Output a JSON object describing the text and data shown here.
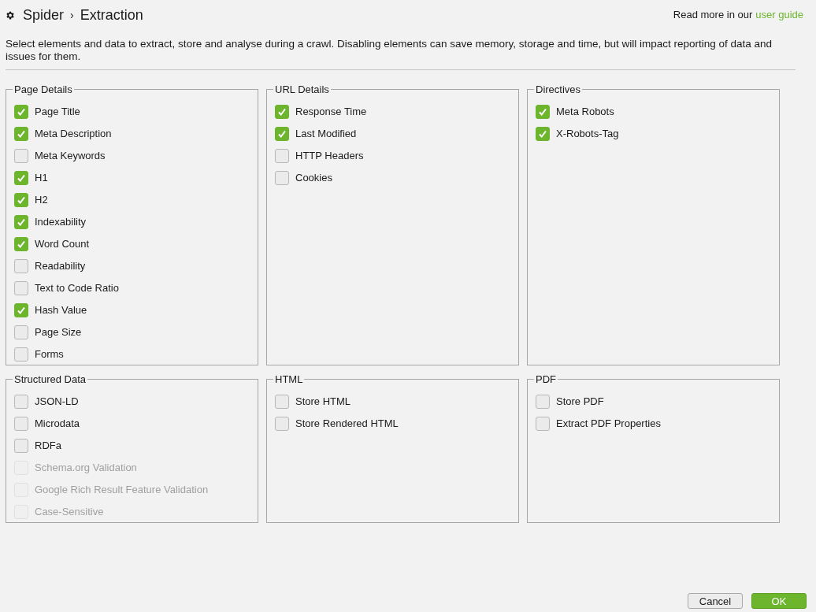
{
  "header": {
    "breadcrumb": [
      "Spider",
      "Extraction"
    ],
    "separator": "›",
    "help_text": "Read more in our",
    "help_link": "user guide"
  },
  "description": "Select elements and data to extract, store and analyse during a crawl. Disabling elements can save memory, storage and time, but will impact reporting of data and issues for them.",
  "groups": [
    {
      "title": "Page Details",
      "items": [
        {
          "label": "Page Title",
          "checked": true,
          "disabled": false
        },
        {
          "label": "Meta Description",
          "checked": true,
          "disabled": false
        },
        {
          "label": "Meta Keywords",
          "checked": false,
          "disabled": false
        },
        {
          "label": "H1",
          "checked": true,
          "disabled": false
        },
        {
          "label": "H2",
          "checked": true,
          "disabled": false
        },
        {
          "label": "Indexability",
          "checked": true,
          "disabled": false
        },
        {
          "label": "Word Count",
          "checked": true,
          "disabled": false
        },
        {
          "label": "Readability",
          "checked": false,
          "disabled": false
        },
        {
          "label": "Text to Code Ratio",
          "checked": false,
          "disabled": false
        },
        {
          "label": "Hash Value",
          "checked": true,
          "disabled": false
        },
        {
          "label": "Page Size",
          "checked": false,
          "disabled": false
        },
        {
          "label": "Forms",
          "checked": false,
          "disabled": false
        }
      ]
    },
    {
      "title": "URL Details",
      "items": [
        {
          "label": "Response Time",
          "checked": true,
          "disabled": false
        },
        {
          "label": "Last Modified",
          "checked": true,
          "disabled": false
        },
        {
          "label": "HTTP Headers",
          "checked": false,
          "disabled": false
        },
        {
          "label": "Cookies",
          "checked": false,
          "disabled": false
        }
      ]
    },
    {
      "title": "Directives",
      "items": [
        {
          "label": "Meta Robots",
          "checked": true,
          "disabled": false
        },
        {
          "label": "X-Robots-Tag",
          "checked": true,
          "disabled": false
        }
      ]
    },
    {
      "title": "Structured Data",
      "items": [
        {
          "label": "JSON-LD",
          "checked": false,
          "disabled": false
        },
        {
          "label": "Microdata",
          "checked": false,
          "disabled": false
        },
        {
          "label": "RDFa",
          "checked": false,
          "disabled": false
        },
        {
          "label": "Schema.org Validation",
          "checked": false,
          "disabled": true
        },
        {
          "label": "Google Rich Result Feature Validation",
          "checked": false,
          "disabled": true
        },
        {
          "label": "Case-Sensitive",
          "checked": false,
          "disabled": true
        }
      ]
    },
    {
      "title": "HTML",
      "items": [
        {
          "label": "Store HTML",
          "checked": false,
          "disabled": false
        },
        {
          "label": "Store Rendered HTML",
          "checked": false,
          "disabled": false
        }
      ]
    },
    {
      "title": "PDF",
      "items": [
        {
          "label": "Store PDF",
          "checked": false,
          "disabled": false
        },
        {
          "label": "Extract PDF Properties",
          "checked": false,
          "disabled": false
        }
      ]
    }
  ],
  "buttons": [
    "Cancel",
    "OK"
  ]
}
